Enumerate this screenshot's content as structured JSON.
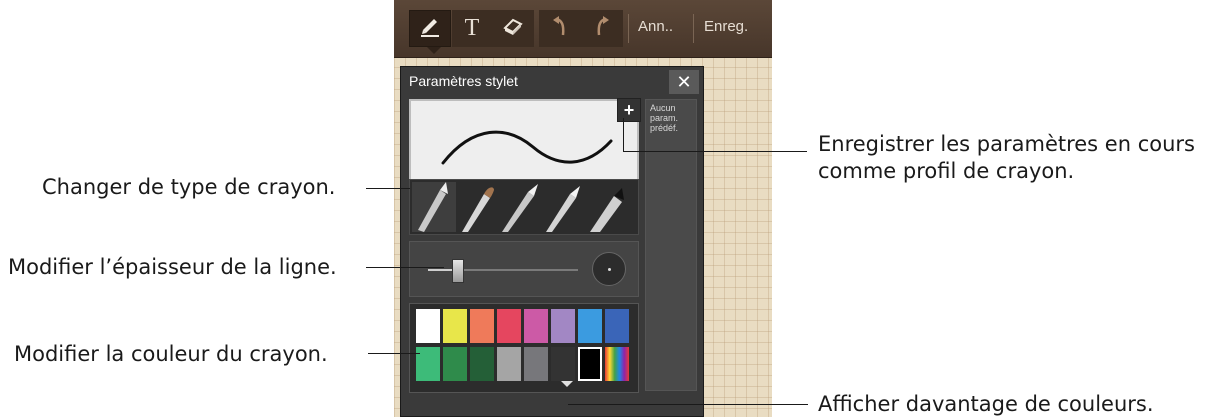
{
  "toolbar": {
    "pen_icon": "pen-icon",
    "text_label": "T",
    "eraser_icon": "eraser-icon",
    "undo_icon": "undo-icon",
    "redo_icon": "redo-icon",
    "cancel_label": "Ann..",
    "save_label": "Enreg."
  },
  "panel": {
    "title": "Paramètres stylet",
    "close_label": "✕",
    "add_preset_label": "+",
    "presets_empty_text": "Aucun param. prédéf.",
    "line_thickness": 0.2,
    "palette": {
      "row1": [
        "#ffffff",
        "#e8e64a",
        "#ef7a5a",
        "#e5465f",
        "#cc5aa6",
        "#a287c4",
        "#3b9be0",
        "#3a65b8"
      ],
      "row2": [
        "#3dbb79",
        "#2f8b4b",
        "#245f37",
        "#a5a5a5",
        "#77777b",
        "#333333",
        "#000000",
        "rainbow"
      ],
      "selected": "#000000"
    }
  },
  "callouts": {
    "save_profile": "Enregistrer les paramètres en cours comme profil de crayon.",
    "save_profile_line1": "Enregistrer les paramètres en cours",
    "save_profile_line2": "comme profil de crayon.",
    "change_pen_type": "Changer de type de crayon.",
    "change_thickness": "Modifier l’épaisseur de la ligne.",
    "change_color": "Modifier la couleur du crayon.",
    "more_colors": "Afficher davantage de couleurs."
  },
  "colors": {
    "toolbar": "#4f3d30",
    "panel": "#3a3a3a",
    "paper": "#e9dcc2"
  }
}
